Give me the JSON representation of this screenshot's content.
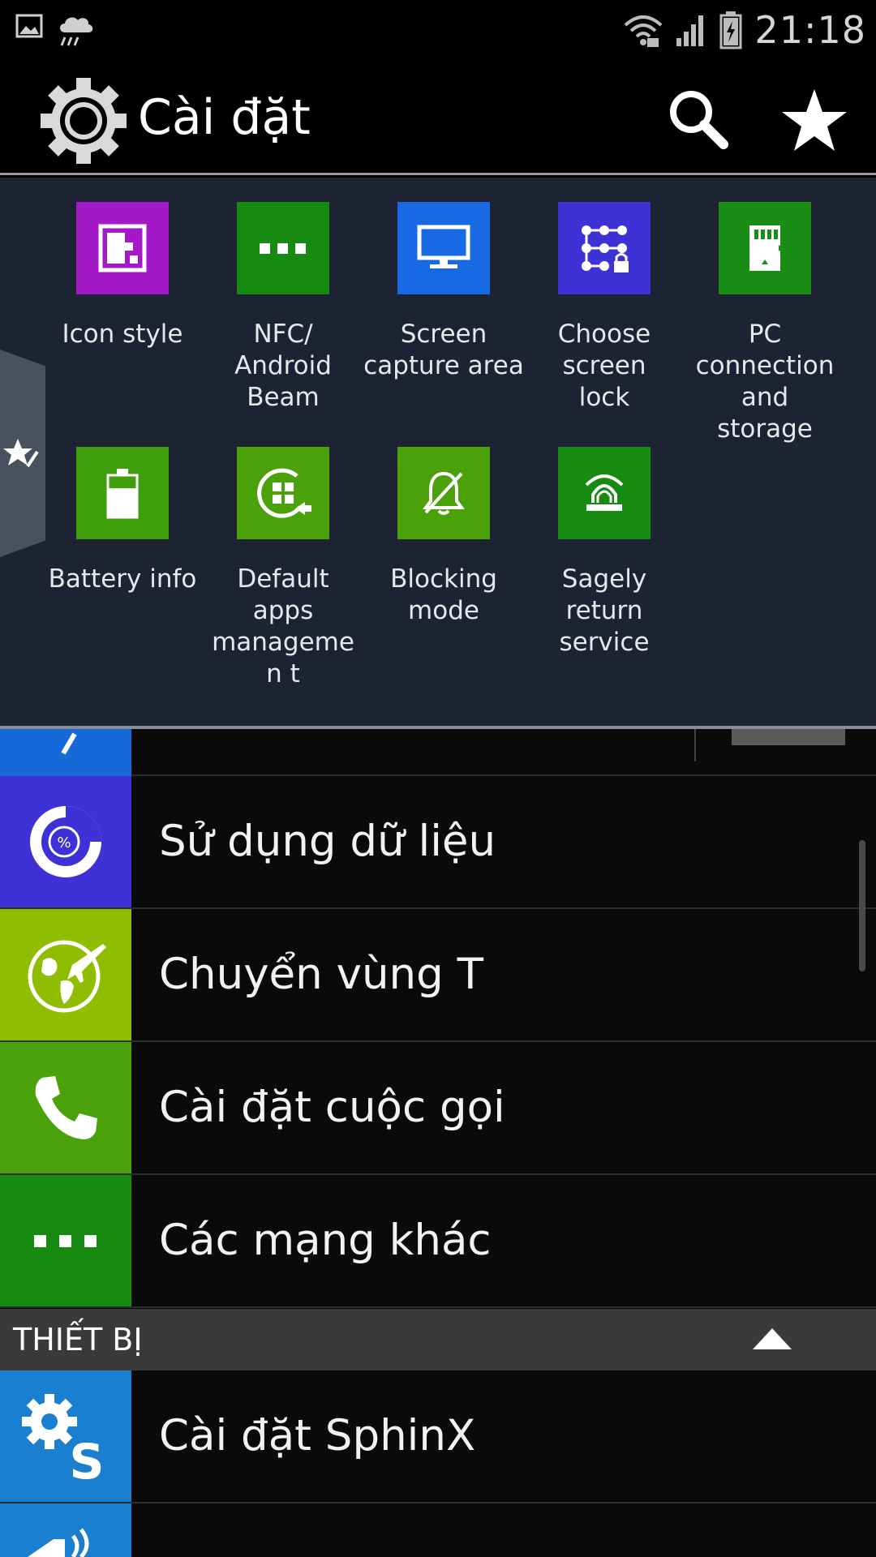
{
  "status_bar": {
    "time": "21:18",
    "left_icons": [
      "gallery-icon",
      "rain-cloud-icon"
    ],
    "right_icons": [
      "wifi-icon",
      "signal-icon",
      "battery-charging-icon"
    ]
  },
  "action_bar": {
    "title": "Cài đặt",
    "icons": [
      "settings-gear-icon",
      "search-icon",
      "favorite-star-icon"
    ]
  },
  "quick_panel": {
    "tiles": [
      {
        "label": "Icon style",
        "icon": "icon-style-icon",
        "color": "#a419c7"
      },
      {
        "label": "NFC/ Android Beam",
        "icon": "dots-icon",
        "color": "#178a12"
      },
      {
        "label": "Screen capture area",
        "icon": "monitor-icon",
        "color": "#1769e4"
      },
      {
        "label": "Choose screen lock",
        "icon": "pattern-lock-icon",
        "color": "#3e31d6"
      },
      {
        "label": "PC connection and storage",
        "icon": "sd-card-icon",
        "color": "#1a8d16"
      },
      {
        "label": "Battery info",
        "icon": "battery-icon",
        "color": "#3f9e0b"
      },
      {
        "label": "Default apps managemen t",
        "icon": "default-apps-icon",
        "color": "#4aa10a"
      },
      {
        "label": "Blocking mode",
        "icon": "bell-off-icon",
        "color": "#4aa10a"
      },
      {
        "label": "Sagely return service",
        "icon": "alarm-light-icon",
        "color": "#178a12"
      }
    ]
  },
  "list": {
    "rows": [
      {
        "label": "Sử dụng dữ liệu",
        "icon": "data-usage-icon",
        "color": "#3e31d6"
      },
      {
        "label": "Chuyển vùng T",
        "icon": "globe-plane-icon",
        "color": "#8fbe00"
      },
      {
        "label": "Cài đặt cuộc gọi",
        "icon": "phone-icon",
        "color": "#4aa10a"
      },
      {
        "label": "Các mạng khác",
        "icon": "dots-icon",
        "color": "#178a12"
      }
    ],
    "section_header": "THIẾT BỊ",
    "device_rows": [
      {
        "label": "Cài đặt SphinX",
        "icon": "sphinx-gear-icon",
        "color": "#1b7fd0"
      }
    ]
  }
}
